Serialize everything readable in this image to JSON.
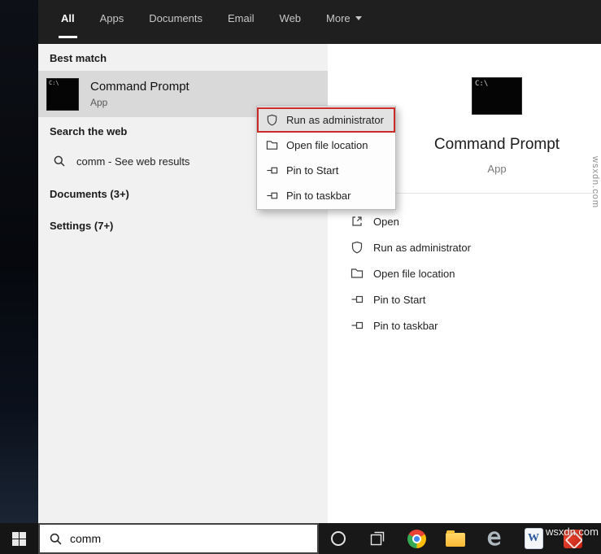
{
  "tabs": {
    "items": [
      {
        "label": "All"
      },
      {
        "label": "Apps"
      },
      {
        "label": "Documents"
      },
      {
        "label": "Email"
      },
      {
        "label": "Web"
      },
      {
        "label": "More"
      }
    ]
  },
  "results": {
    "best_match_header": "Best match",
    "best_match": {
      "title": "Command Prompt",
      "subtitle": "App"
    },
    "web_header": "Search the web",
    "web_query": "comm",
    "web_suffix": " - See web results",
    "documents_header": "Documents (3+)",
    "settings_header": "Settings (7+)"
  },
  "context_menu": {
    "items": [
      {
        "label": "Run as administrator"
      },
      {
        "label": "Open file location"
      },
      {
        "label": "Pin to Start"
      },
      {
        "label": "Pin to taskbar"
      }
    ]
  },
  "preview": {
    "title": "Command Prompt",
    "subtitle": "App",
    "actions": [
      {
        "label": "Open"
      },
      {
        "label": "Run as administrator"
      },
      {
        "label": "Open file location"
      },
      {
        "label": "Pin to Start"
      },
      {
        "label": "Pin to taskbar"
      }
    ]
  },
  "taskbar": {
    "search_value": "comm"
  },
  "icons": {
    "cmd_text": "C:\\"
  },
  "watermark": {
    "text": "wsxdn.com"
  },
  "colors": {
    "annotation_red": "#cb2a27",
    "topbar_bg": "#1f1f1f",
    "left_panel_bg": "#f1f1f1",
    "highlight_row": "#d9d9d9",
    "taskbar_bg": "#181818"
  }
}
